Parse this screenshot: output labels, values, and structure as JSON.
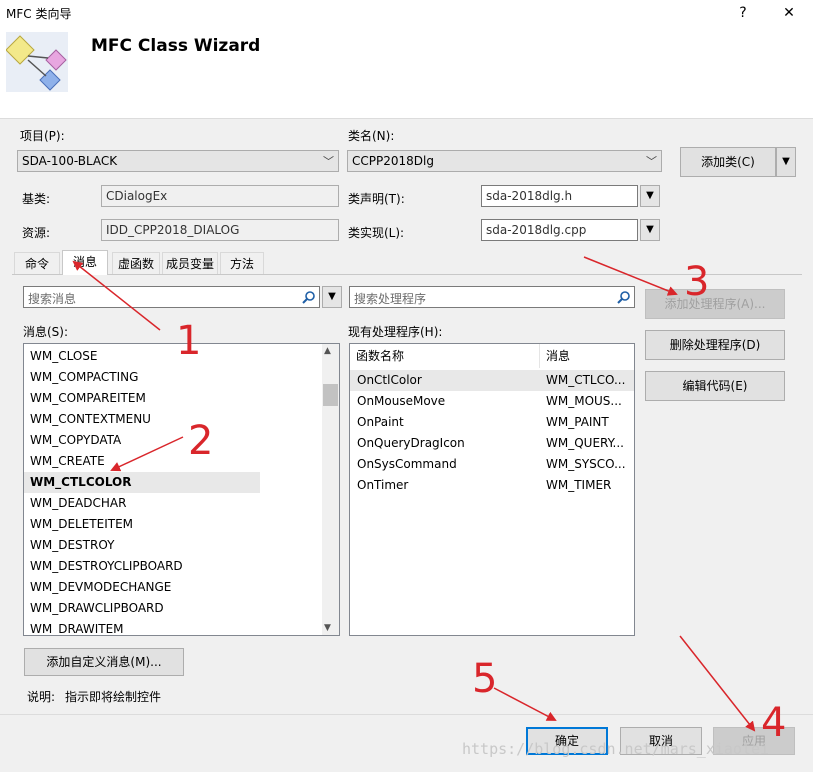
{
  "window": {
    "title": "MFC 类向导",
    "help_glyph": "?",
    "close_glyph": "✕"
  },
  "header": {
    "title": "MFC Class Wizard"
  },
  "project": {
    "label": "项目(P):",
    "value": "SDA-100-BLACK"
  },
  "class_name": {
    "label": "类名(N):",
    "value": "CCPP2018Dlg"
  },
  "add_class_button": {
    "label": "添加类(C)"
  },
  "base_class": {
    "label": "基类:",
    "value": "CDialogEx"
  },
  "class_decl": {
    "label": "类声明(T):",
    "value": "sda-2018dlg.h"
  },
  "resource": {
    "label": "资源:",
    "value": "IDD_CPP2018_DIALOG"
  },
  "class_impl": {
    "label": "类实现(L):",
    "value": "sda-2018dlg.cpp"
  },
  "tabs": [
    {
      "label": "命令"
    },
    {
      "label": "消息"
    },
    {
      "label": "虚函数"
    },
    {
      "label": "成员变量"
    },
    {
      "label": "方法"
    }
  ],
  "search_messages": {
    "placeholder": "搜索消息"
  },
  "search_handlers": {
    "placeholder": "搜索处理程序"
  },
  "messages": {
    "label": "消息(S):",
    "items": [
      "WM_CLOSE",
      "WM_COMPACTING",
      "WM_COMPAREITEM",
      "WM_CONTEXTMENU",
      "WM_COPYDATA",
      "WM_CREATE",
      "WM_CTLCOLOR",
      "WM_DEADCHAR",
      "WM_DELETEITEM",
      "WM_DESTROY",
      "WM_DESTROYCLIPBOARD",
      "WM_DEVMODECHANGE",
      "WM_DRAWCLIPBOARD",
      "WM_DRAWITEM"
    ],
    "selected_index": 6
  },
  "handlers": {
    "label": "现有处理程序(H):",
    "columns": [
      "函数名称",
      "消息"
    ],
    "rows": [
      [
        "OnCtlColor",
        "WM_CTLCO..."
      ],
      [
        "OnMouseMove",
        "WM_MOUS..."
      ],
      [
        "OnPaint",
        "WM_PAINT"
      ],
      [
        "OnQueryDragIcon",
        "WM_QUERY..."
      ],
      [
        "OnSysCommand",
        "WM_SYSCO..."
      ],
      [
        "OnTimer",
        "WM_TIMER"
      ]
    ]
  },
  "buttons": {
    "add_handler": "添加处理程序(A)...",
    "delete_handler": "删除处理程序(D)",
    "edit_code": "编辑代码(E)",
    "add_custom_message": "添加自定义消息(M)...",
    "ok": "确定",
    "cancel": "取消",
    "apply": "应用"
  },
  "description": {
    "label": "说明:",
    "text": "指示即将绘制控件"
  },
  "annotations": [
    "1",
    "2",
    "3",
    "4",
    "5"
  ],
  "watermark": "https://blog.csdn.net/mars_xiaolei",
  "colors": {
    "accent": "#0078d7",
    "arrow": "#d9262b"
  }
}
